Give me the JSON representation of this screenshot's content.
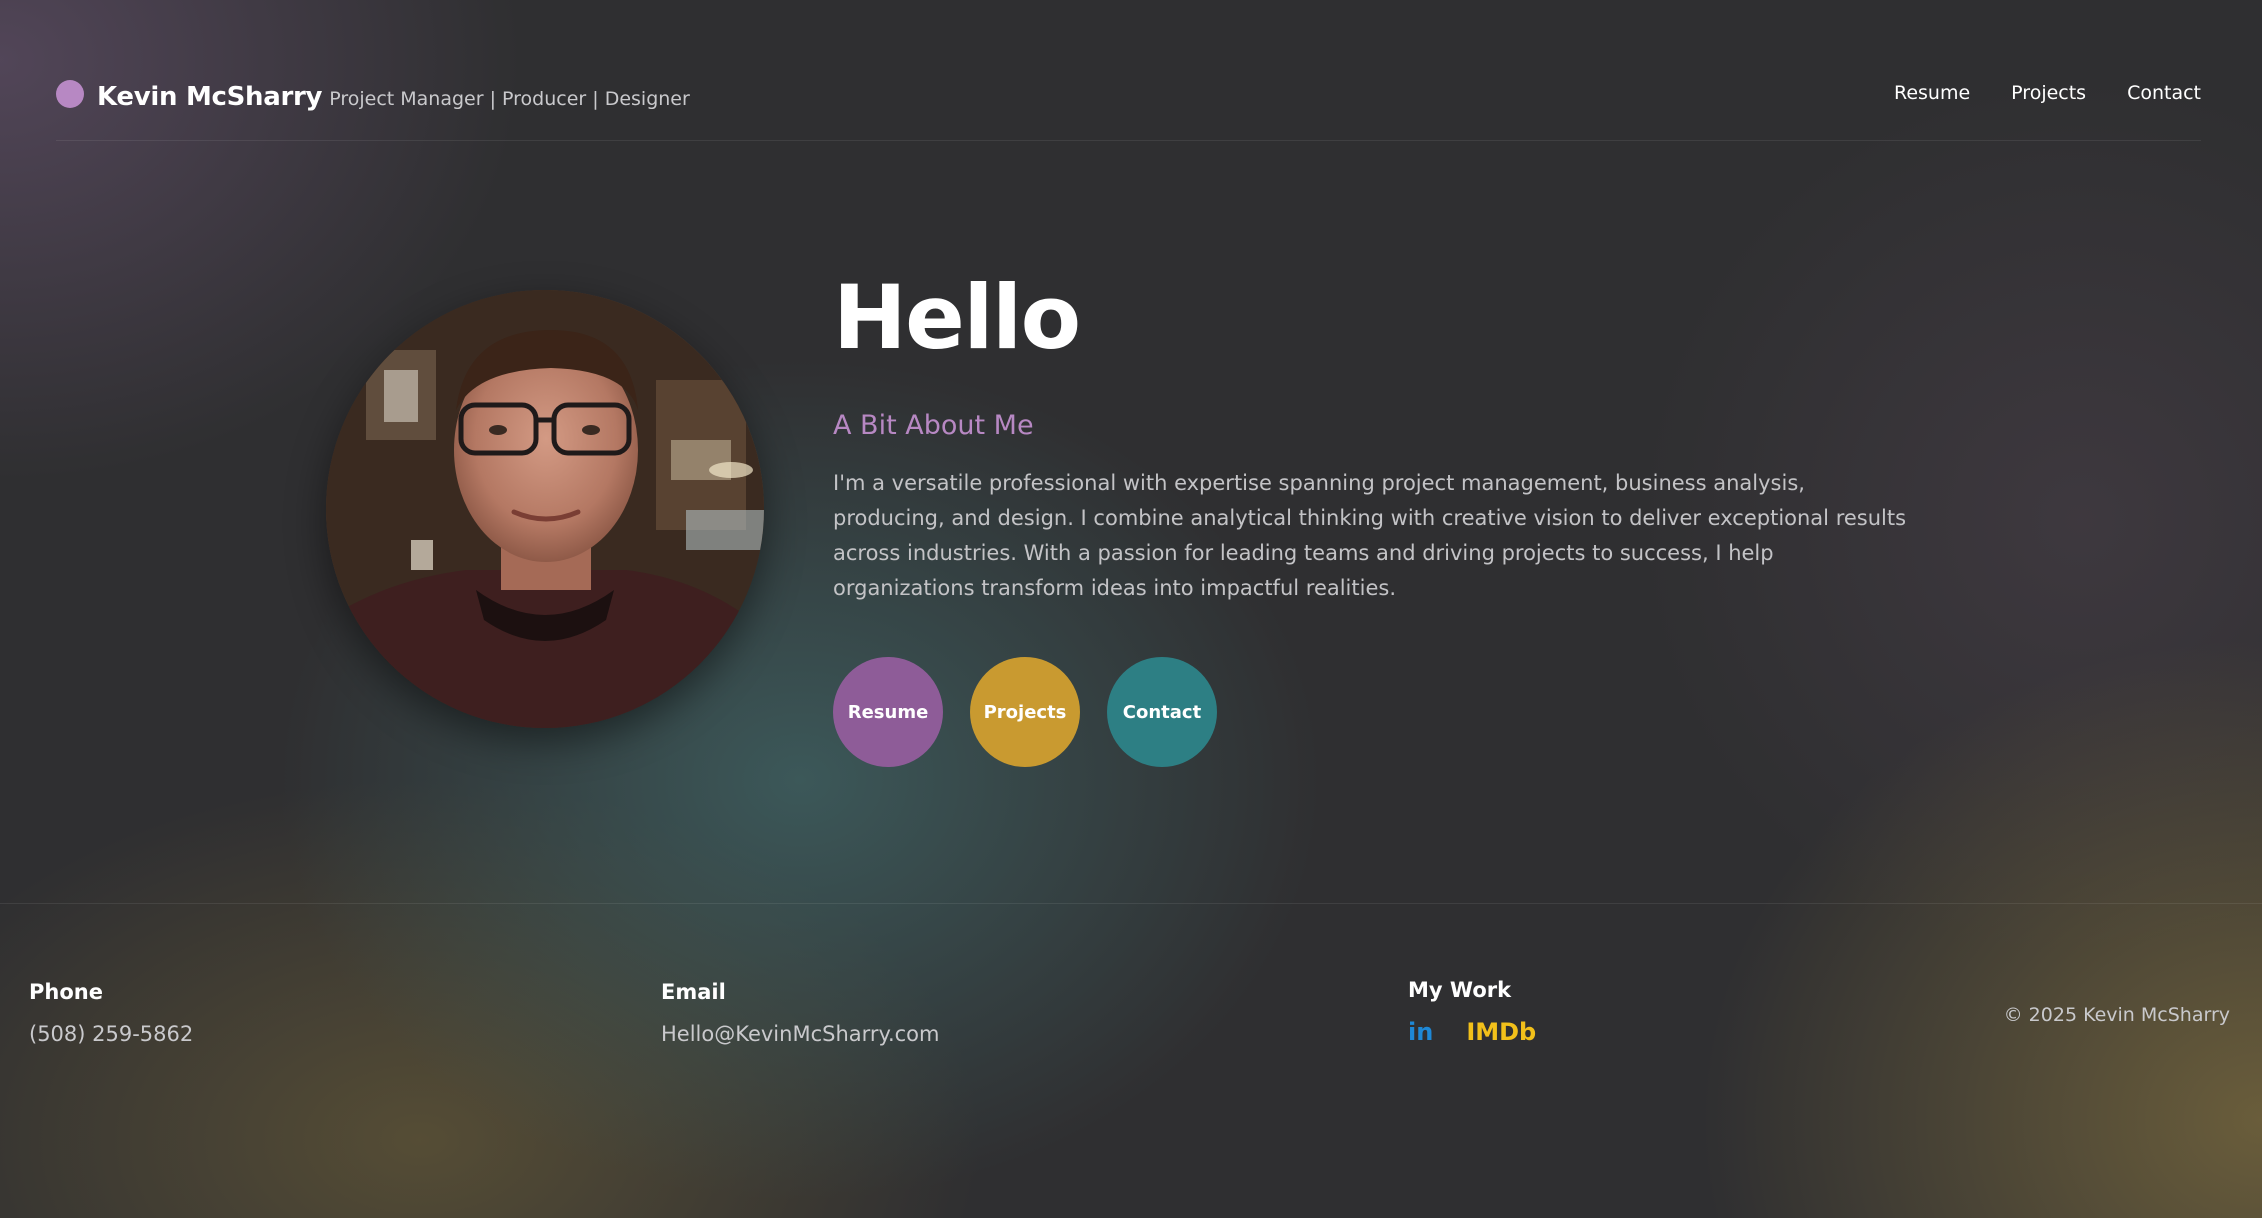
{
  "header": {
    "name": "Kevin McSharry",
    "tagline": "Project Manager | Producer | Designer",
    "nav": [
      {
        "label": "Resume"
      },
      {
        "label": "Projects"
      },
      {
        "label": "Contact"
      }
    ]
  },
  "hero": {
    "title": "Hello",
    "subtitle": "A Bit About Me",
    "bio": "I'm a versatile professional with expertise spanning project management, business analysis, producing, and design. I combine analytical thinking with creative vision to deliver exceptional results across industries. With a passion for leading teams and driving projects to success, I help organizations transform ideas into impactful realities.",
    "buttons": [
      {
        "label": "Resume",
        "color": "#8e5c98"
      },
      {
        "label": "Projects",
        "color": "#c99a30"
      },
      {
        "label": "Contact",
        "color": "#2d7f84"
      }
    ]
  },
  "footer": {
    "phone": {
      "heading": "Phone",
      "value": "(508) 259-5862"
    },
    "email": {
      "heading": "Email",
      "value": "Hello@KevinMcSharry.com"
    },
    "work": {
      "heading": "My Work",
      "links": [
        {
          "label": "in",
          "icon": "linkedin-icon",
          "color": "#1e88d6"
        },
        {
          "label": "IMDb",
          "icon": "imdb-icon",
          "color": "#f2c01a"
        }
      ]
    },
    "copyright": "© 2025 Kevin McSharry"
  },
  "colors": {
    "accent_purple": "#b788c3",
    "background": "#2f2f31"
  }
}
